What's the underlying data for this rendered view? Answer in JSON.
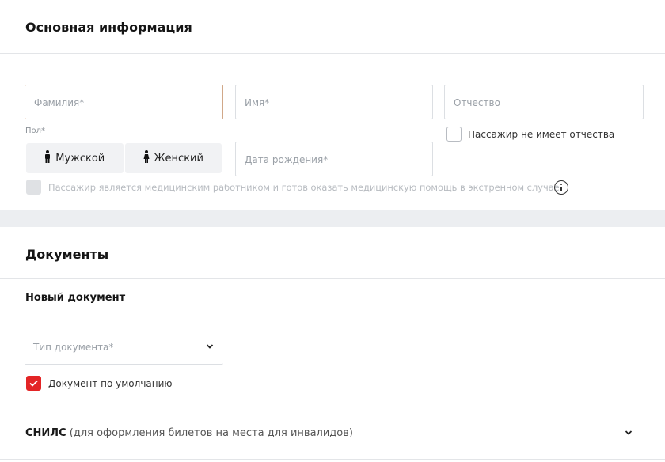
{
  "basic_info": {
    "title": "Основная информация",
    "surname_placeholder": "Фамилия*",
    "name_placeholder": "Имя*",
    "patronymic_placeholder": "Отчество",
    "gender_label": "Пол*",
    "gender_male": "Мужской",
    "gender_female": "Женский",
    "birthdate_placeholder": "Дата рождения*",
    "no_patronymic_label": "Пассажир не имеет отчества",
    "medical_worker_label": "Пассажир является медицинским работником и готов оказать медицинскую помощь в экстренном случае."
  },
  "documents": {
    "title": "Документы",
    "new_document_title": "Новый документ",
    "doc_type_placeholder": "Тип документа*",
    "default_doc_label": "Документ по умолчанию",
    "default_doc_checked": true,
    "snils_title": "СНИЛС",
    "snils_subtitle": "(для оформления билетов на места для инвалидов)"
  },
  "colors": {
    "accent_red": "#e32526",
    "focus_orange": "#d67a3a",
    "section_gap": "#eceef1"
  },
  "icons": {
    "info": "info-icon",
    "chevron": "chevron-down-icon",
    "male": "male-person-icon",
    "female": "female-person-icon",
    "check": "check-icon"
  }
}
